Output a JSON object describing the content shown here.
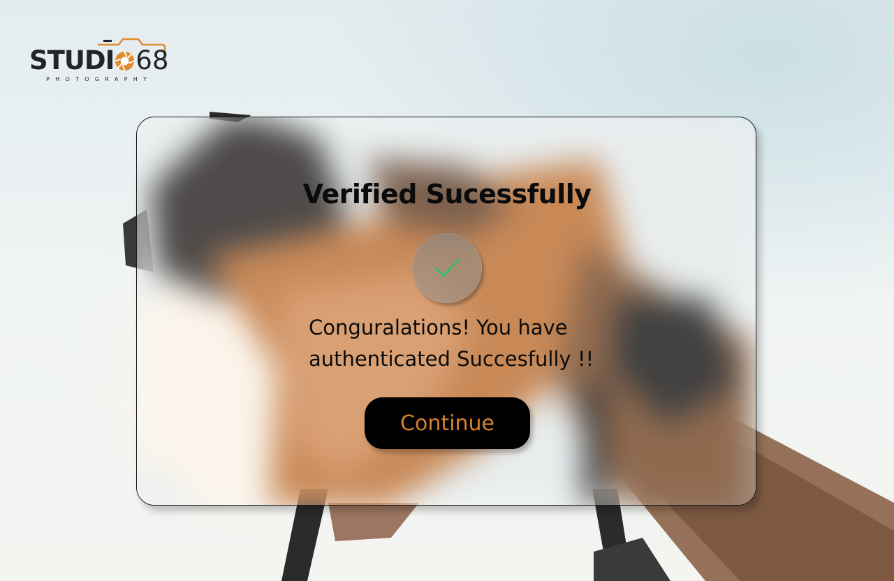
{
  "logo": {
    "text_main": "STUDI",
    "text_number": "68",
    "subtitle": "PHOTOGRAPHY",
    "accent_color": "#e28b2c"
  },
  "dialog": {
    "title": "Verified Sucessfully",
    "status_icon": "checkmark-icon",
    "status_color": "#22c55e",
    "message": "Conguralations! You have authenticated Succesfully !!",
    "continue_label": "Continue",
    "continue_text_color": "#d5822d"
  }
}
